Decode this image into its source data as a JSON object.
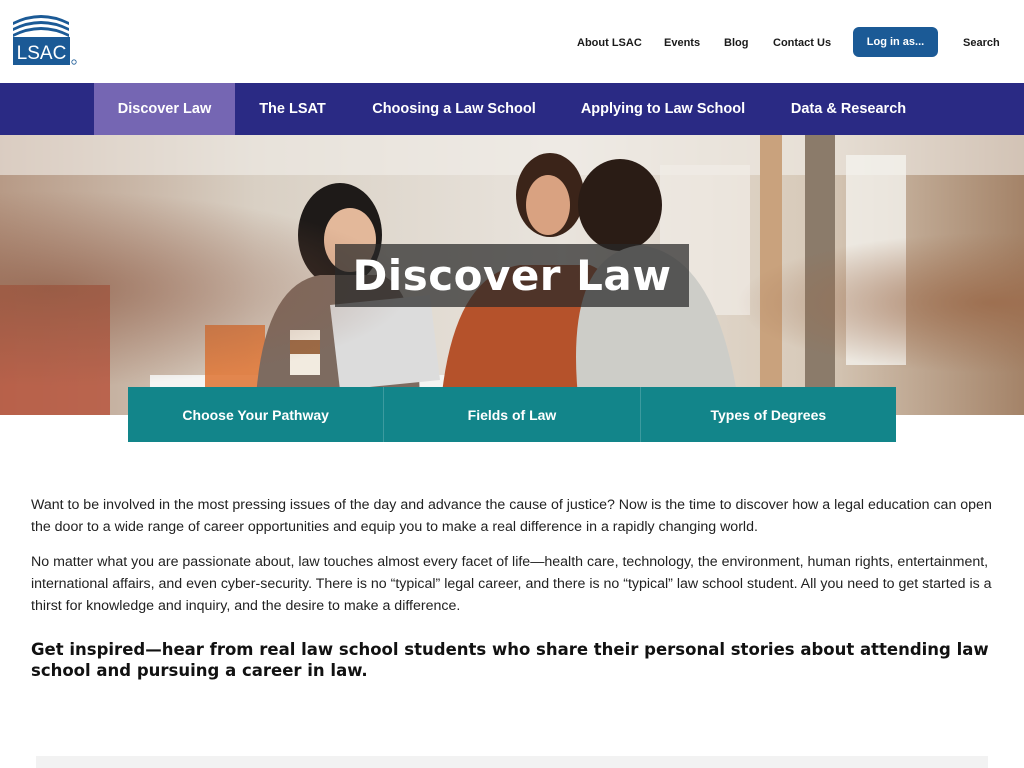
{
  "header": {
    "logo_text": "LSAC",
    "util_links": [
      "About LSAC",
      "Events",
      "Blog",
      "Contact Us"
    ],
    "login_label": "Log in as...",
    "search_label": "Search"
  },
  "nav": {
    "items": [
      "Discover Law",
      "The LSAT",
      "Choosing a Law School",
      "Applying to Law School",
      "Data & Research"
    ],
    "active": "Discover Law"
  },
  "hero": {
    "title": "Discover Law"
  },
  "subtabs": [
    "Choose Your Pathway",
    "Fields of Law",
    "Types of Degrees"
  ],
  "content": {
    "paragraphs": [
      "Want to be involved in the most pressing issues of the day and advance the cause of justice? Now is the time to discover how a legal education can open the door to a wide range of career opportunities and equip you to make a real difference in a rapidly changing world.",
      "No matter what you are passionate about, law touches almost every facet of life—health care, technology, the environment, human rights, entertainment, international affairs, and even cyber-security. There is no “typical” legal career, and there is no “typical” law school student. All you need to get started is a thirst for knowledge and inquiry, and the desire to make a difference."
    ],
    "heading": "Get inspired—hear from real law school students who share their personal stories about attending law school and pursuing a career in law."
  },
  "colors": {
    "brand_blue": "#1b5a96",
    "nav_bg": "#2a2a84",
    "nav_active": "#7566b3",
    "subtab_bg": "#12858a"
  }
}
